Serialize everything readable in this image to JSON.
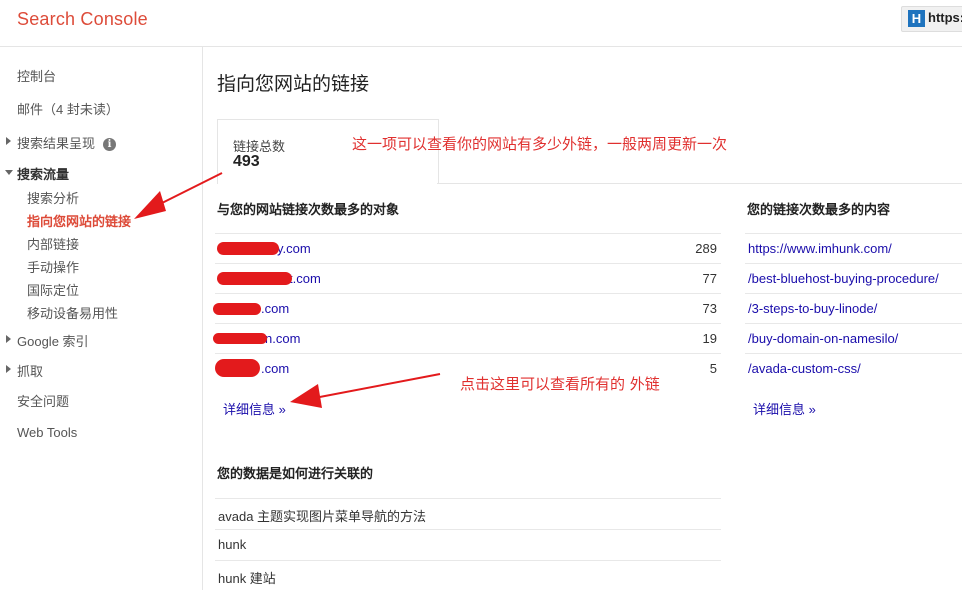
{
  "app": {
    "brand": "Search Console",
    "url_chip_icon": "H",
    "url_chip_text": "https:"
  },
  "sidebar": {
    "items": [
      {
        "label": "控制台"
      },
      {
        "label": "邮件（4 封未读）"
      },
      {
        "label": "搜索结果呈现",
        "icon": "info-icon"
      },
      {
        "label": "搜索流量"
      },
      {
        "label": "搜索分析"
      },
      {
        "label": "指向您网站的链接"
      },
      {
        "label": "内部链接"
      },
      {
        "label": "手动操作"
      },
      {
        "label": "国际定位"
      },
      {
        "label": "移动设备易用性"
      },
      {
        "label": "Google 索引"
      },
      {
        "label": "抓取"
      },
      {
        "label": "安全问题"
      },
      {
        "label": "Web Tools"
      }
    ]
  },
  "main": {
    "title": "指向您网站的链接",
    "stat": {
      "label": "链接总数",
      "value": "493"
    },
    "annotation_top": "这一项可以查看你的网站有多少外链，一般两周更新一次",
    "annotation_mid": "点击这里可以查看所有的 外链",
    "top_linking_sites": {
      "title": "与您的网站链接次数最多的对象",
      "rows": [
        {
          "domain": "y.com",
          "count": "289"
        },
        {
          "domain": "t.com",
          "count": "77"
        },
        {
          "domain": ".com",
          "count": "73"
        },
        {
          "domain": "n.com",
          "count": "19"
        },
        {
          "domain": ".com",
          "count": "5"
        }
      ],
      "more": "详细信息 »"
    },
    "top_linked_content": {
      "title": "您的链接次数最多的内容",
      "rows": [
        {
          "url": "https://www.imhunk.com/"
        },
        {
          "url": "/best-bluehost-buying-procedure/"
        },
        {
          "url": "/3-steps-to-buy-linode/"
        },
        {
          "url": "/buy-domain-on-namesilo/"
        },
        {
          "url": "/avada-custom-css/"
        }
      ],
      "more": "详细信息 »"
    },
    "anchor_text": {
      "title": "您的数据是如何进行关联的",
      "rows": [
        {
          "text": "avada 主题实现图片菜单导航的方法"
        },
        {
          "text": "hunk"
        },
        {
          "text": "hunk 建站"
        }
      ]
    }
  }
}
